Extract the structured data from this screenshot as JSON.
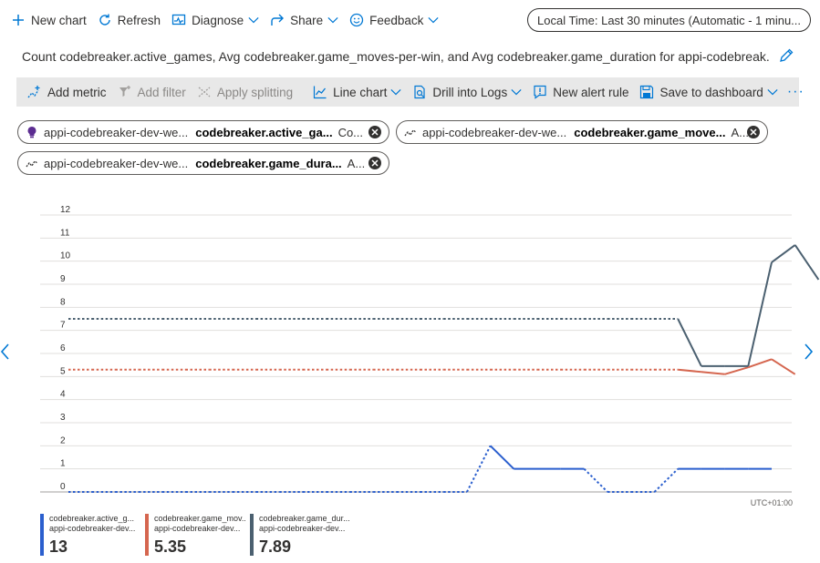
{
  "commandbar": {
    "new_chart": "New chart",
    "refresh": "Refresh",
    "diagnose": "Diagnose",
    "share": "Share",
    "feedback": "Feedback",
    "time_range": "Local Time: Last 30 minutes (Automatic - 1 minu..."
  },
  "title": "Count codebreaker.active_games, Avg codebreaker.game_moves-per-win, and Avg codebreaker.game_duration for appi-codebreak...",
  "toolbar": {
    "add_metric": "Add metric",
    "add_filter": "Add filter",
    "apply_splitting": "Apply splitting",
    "line_chart": "Line chart",
    "drill_logs": "Drill into Logs",
    "new_alert": "New alert rule",
    "save_dashboard": "Save to dashboard",
    "more": "···"
  },
  "pills": [
    {
      "resource": "appi-codebreaker-dev-we...",
      "metric": "codebreaker.active_ga...",
      "agg": "Co..."
    },
    {
      "resource": "appi-codebreaker-dev-we...",
      "metric": "codebreaker.game_move...",
      "agg": "A..."
    },
    {
      "resource": "appi-codebreaker-dev-we...",
      "metric": "codebreaker.game_dura...",
      "agg": "A..."
    }
  ],
  "timezone": "UTC+01:00",
  "chart_data": {
    "type": "line",
    "ylim": [
      0,
      12
    ],
    "y_ticks": [
      "0",
      "1",
      "2",
      "3",
      "4",
      "5",
      "6",
      "7",
      "8",
      "9",
      "10",
      "11",
      "12"
    ],
    "x_index": [
      0,
      1,
      2,
      3,
      4,
      5,
      6,
      7,
      8,
      9,
      10,
      11,
      12,
      13,
      14,
      15,
      16,
      17,
      18,
      19,
      20,
      21,
      22,
      23,
      24,
      25,
      26,
      27,
      28,
      29,
      30
    ],
    "series": [
      {
        "name": "codebreaker.active_g...",
        "color": "#2b5fce",
        "values": [
          0,
          0,
          0,
          0,
          0,
          0,
          0,
          0,
          0,
          0,
          0,
          0,
          0,
          0,
          0,
          0,
          0,
          0,
          2,
          1,
          1,
          1,
          1,
          0,
          0,
          0,
          1,
          1,
          1,
          1,
          1
        ],
        "dotted_segments": [
          [
            0,
            18
          ],
          [
            22,
            26
          ]
        ]
      },
      {
        "name": "codebreaker.game_mov...",
        "color": "#d5664f",
        "values": [
          5.3,
          5.3,
          5.3,
          5.3,
          5.3,
          5.3,
          5.3,
          5.3,
          5.3,
          5.3,
          5.3,
          5.3,
          5.3,
          5.3,
          5.3,
          5.3,
          5.3,
          5.3,
          5.3,
          5.3,
          5.3,
          5.3,
          5.3,
          5.3,
          5.3,
          5.3,
          5.3,
          5.2,
          5.1,
          5.4,
          5.75,
          5.1
        ],
        "dotted_segments": [
          [
            0,
            26
          ]
        ]
      },
      {
        "name": "codebreaker.game_dur...",
        "color": "#4b6070",
        "values": [
          7.5,
          7.5,
          7.5,
          7.5,
          7.5,
          7.5,
          7.5,
          7.5,
          7.5,
          7.5,
          7.5,
          7.5,
          7.5,
          7.5,
          7.5,
          7.5,
          7.5,
          7.5,
          7.5,
          7.5,
          7.5,
          7.5,
          7.5,
          7.5,
          7.5,
          7.5,
          7.5,
          5.45,
          5.45,
          5.45,
          9.95,
          10.7,
          9.2
        ],
        "dotted_segments": [
          [
            0,
            26
          ]
        ]
      }
    ]
  },
  "legend": [
    {
      "line1": "codebreaker.active_g...",
      "line2": "appi-codebreaker-dev...",
      "value": "13",
      "color": "#2b5fce"
    },
    {
      "line1": "codebreaker.game_mov...",
      "line2": "appi-codebreaker-dev...",
      "value": "5.35",
      "color": "#d5664f"
    },
    {
      "line1": "codebreaker.game_dur...",
      "line2": "appi-codebreaker-dev...",
      "value": "7.89",
      "color": "#4b6070"
    }
  ]
}
